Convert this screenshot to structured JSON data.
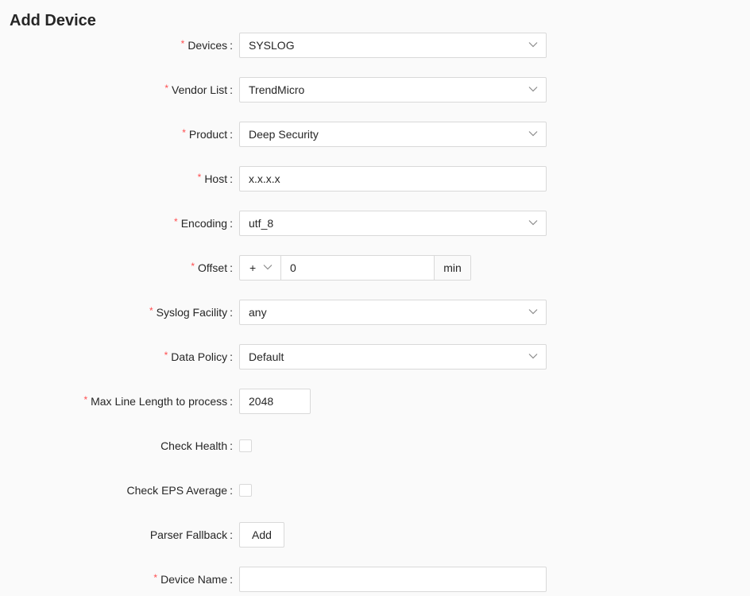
{
  "page": {
    "title": "Add Device"
  },
  "form": {
    "devices": {
      "label": "Devices",
      "value": "SYSLOG",
      "required": true
    },
    "vendor_list": {
      "label": "Vendor List",
      "value": "TrendMicro",
      "required": true
    },
    "product": {
      "label": "Product",
      "value": "Deep Security",
      "required": true
    },
    "host": {
      "label": "Host",
      "value": "x.x.x.x",
      "required": true
    },
    "encoding": {
      "label": "Encoding",
      "value": "utf_8",
      "required": true
    },
    "offset": {
      "label": "Offset",
      "sign": "+",
      "value": "0",
      "unit": "min",
      "required": true
    },
    "syslog_facility": {
      "label": "Syslog Facility",
      "value": "any",
      "required": true
    },
    "data_policy": {
      "label": "Data Policy",
      "value": "Default",
      "required": true
    },
    "max_line_length": {
      "label": "Max Line Length to process",
      "value": "2048",
      "required": true
    },
    "check_health": {
      "label": "Check Health",
      "checked": false
    },
    "check_eps_average": {
      "label": "Check EPS Average",
      "checked": false
    },
    "parser_fallback": {
      "label": "Parser Fallback",
      "button_label": "Add"
    },
    "device_name": {
      "label": "Device Name",
      "value": "",
      "required": true
    }
  },
  "symbols": {
    "required_mark": "*",
    "colon": ":"
  }
}
